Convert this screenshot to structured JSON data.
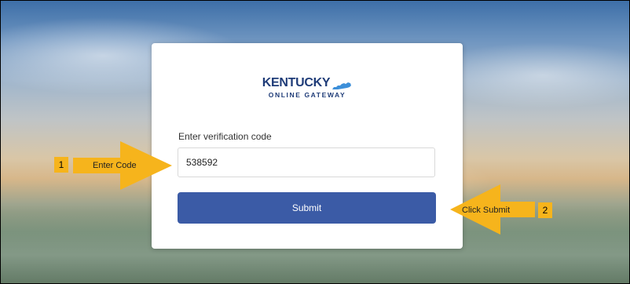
{
  "logo": {
    "line1": "KENTUCKY",
    "line2": "ONLINE GATEWAY",
    "brand_color": "#1f3c78",
    "accent_color": "#3d8fd9"
  },
  "form": {
    "code_label": "Enter verification code",
    "code_value": "538592",
    "submit_label": "Submit",
    "submit_color": "#3b5ba6"
  },
  "annotations": {
    "step1": {
      "number": "1",
      "text": "Enter Code"
    },
    "step2": {
      "number": "2",
      "text": "Click Submit"
    },
    "callout_color": "#f6b41c"
  }
}
